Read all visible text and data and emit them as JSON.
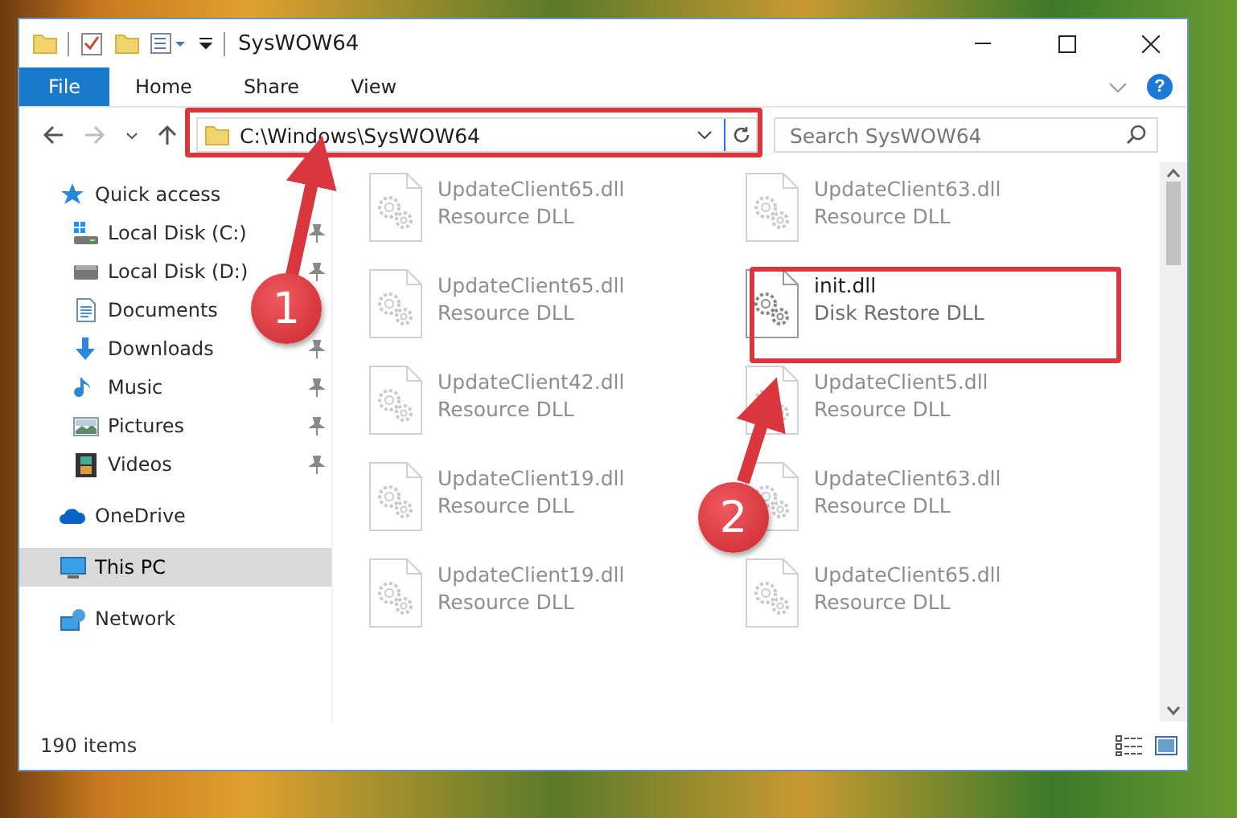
{
  "window": {
    "title": "SysWOW64"
  },
  "ribbon": {
    "tabs": [
      {
        "label": "File",
        "selected": true
      },
      {
        "label": "Home",
        "selected": false
      },
      {
        "label": "Share",
        "selected": false
      },
      {
        "label": "View",
        "selected": false
      }
    ],
    "help": "?"
  },
  "address_bar": {
    "path": "C:\\Windows\\SysWOW64"
  },
  "search": {
    "placeholder": "Search SysWOW64"
  },
  "navigation": [
    {
      "label": "Quick access",
      "kind": "star",
      "selected": false,
      "children": [
        {
          "label": "Local Disk (C:)",
          "kind": "drive-windows",
          "pinned": true,
          "selected": false
        },
        {
          "label": "Local Disk (D:)",
          "kind": "drive",
          "pinned": true,
          "selected": false
        },
        {
          "label": "Documents",
          "kind": "documents",
          "pinned": false,
          "selected": false
        },
        {
          "label": "Downloads",
          "kind": "downloads",
          "pinned": true,
          "selected": false
        },
        {
          "label": "Music",
          "kind": "music",
          "pinned": true,
          "selected": false
        },
        {
          "label": "Pictures",
          "kind": "pictures",
          "pinned": true,
          "selected": false
        },
        {
          "label": "Videos",
          "kind": "videos",
          "pinned": true,
          "selected": false
        }
      ]
    },
    {
      "label": "OneDrive",
      "kind": "cloud",
      "selected": false
    },
    {
      "label": "This PC",
      "kind": "pc",
      "selected": true
    },
    {
      "label": "Network",
      "kind": "network",
      "selected": false
    }
  ],
  "files": [
    {
      "name": "UpdateClient65.dll",
      "type": "Resource DLL",
      "dimmed": true
    },
    {
      "name": "UpdateClient63.dll",
      "type": "Resource DLL",
      "dimmed": true
    },
    {
      "name": "UpdateClient65.dll",
      "type": "Resource DLL",
      "dimmed": true
    },
    {
      "name": "init.dll",
      "type": "Disk Restore DLL",
      "dimmed": false
    },
    {
      "name": "UpdateClient42.dll",
      "type": "Resource DLL",
      "dimmed": true
    },
    {
      "name": "UpdateClient5.dll",
      "type": "Resource DLL",
      "dimmed": true
    },
    {
      "name": "UpdateClient19.dll",
      "type": "Resource DLL",
      "dimmed": true
    },
    {
      "name": "UpdateClient63.dll",
      "type": "Resource DLL",
      "dimmed": true
    },
    {
      "name": "UpdateClient19.dll",
      "type": "Resource DLL",
      "dimmed": true
    },
    {
      "name": "UpdateClient65.dll",
      "type": "Resource DLL",
      "dimmed": true
    }
  ],
  "status_bar": {
    "item_count": "190 items"
  },
  "annotations": [
    {
      "number": "1"
    },
    {
      "number": "2"
    }
  ]
}
